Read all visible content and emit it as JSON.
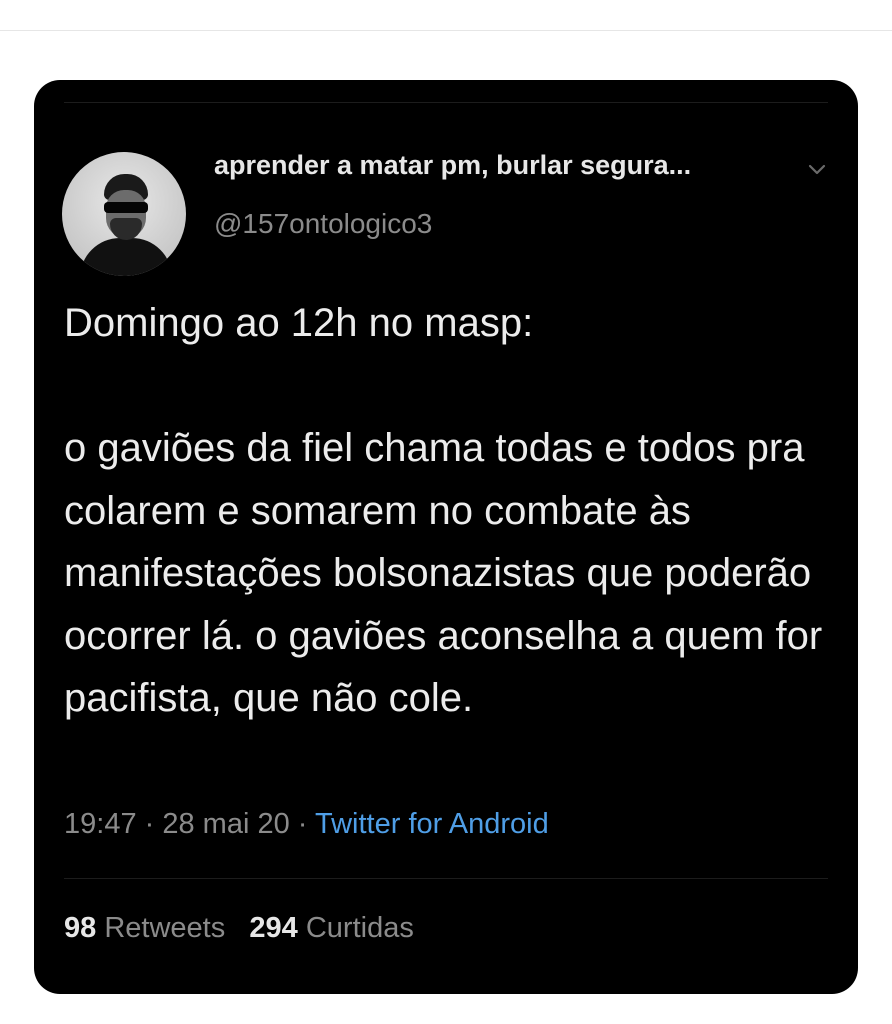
{
  "tweet": {
    "display_name": "aprender a matar pm, burlar segura...",
    "handle": "@157ontologico3",
    "menu_icon": "chevron-down-icon",
    "body": "Domingo ao 12h no masp:\n\no gaviões da fiel chama todas e todos pra colarem e somarem no combate às manifestações bolsonazistas que poderão ocorrer lá. o gaviões aconselha a quem for pacifista, que não cole.",
    "time": "19:47",
    "date": "28 mai 20",
    "source": "Twitter for Android",
    "retweets_count": "98",
    "retweets_label": "Retweets",
    "likes_count": "294",
    "likes_label": "Curtidas"
  },
  "colors": {
    "background": "#000000",
    "text": "#e7e7e7",
    "muted": "#8b8b8b",
    "link": "#4f9ee6"
  }
}
